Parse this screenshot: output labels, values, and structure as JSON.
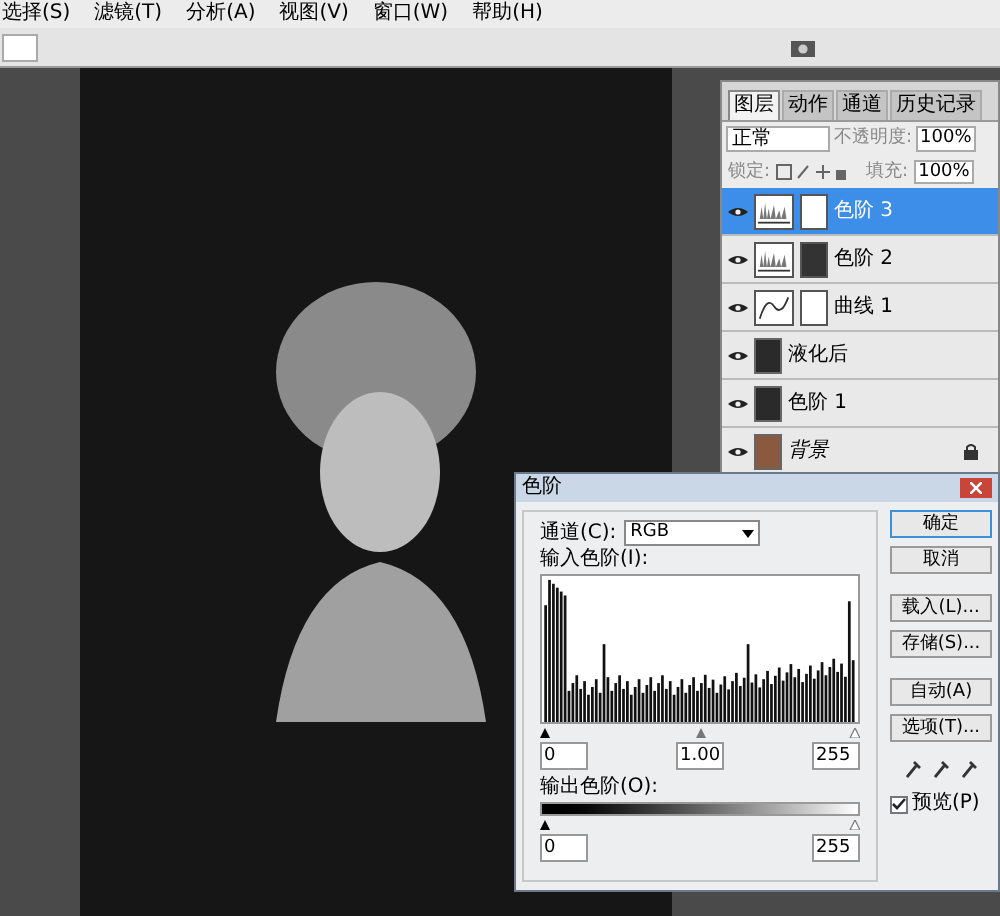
{
  "menu_bar": {
    "items": [
      "选择(S)",
      "滤镜(T)",
      "分析(A)",
      "视图(V)",
      "窗口(W)",
      "帮助(H)"
    ]
  },
  "layers_panel": {
    "tabs": [
      {
        "label": "图层",
        "selected": true
      },
      {
        "label": "动作",
        "selected": false
      },
      {
        "label": "通道",
        "selected": false
      },
      {
        "label": "历史记录",
        "selected": false
      }
    ],
    "blend_mode": "正常",
    "opacity_label": "不透明度:",
    "opacity": "100%",
    "lock_label": "锁定:",
    "fill_label": "填充:",
    "fill": "100%",
    "layers": [
      {
        "name": "色阶 3",
        "kind": "levels",
        "mask": {
          "kind": "blank"
        },
        "selected": true,
        "locked": false
      },
      {
        "name": "色阶 2",
        "kind": "levels",
        "mask": {
          "kind": "photo"
        },
        "selected": false,
        "locked": false
      },
      {
        "name": "曲线 1",
        "kind": "curves",
        "mask": {
          "kind": "blank"
        },
        "selected": false,
        "locked": false
      },
      {
        "name": "液化后",
        "kind": "pixel",
        "selected": false,
        "locked": false
      },
      {
        "name": "色阶 1",
        "kind": "pixel",
        "selected": false,
        "locked": false
      },
      {
        "name": "背景",
        "kind": "background",
        "selected": false,
        "locked": true
      }
    ]
  },
  "levels_dialog": {
    "title": "色阶",
    "channel_label": "通道(C):",
    "channel": "RGB",
    "input_label": "输入色阶(I):",
    "input_values": [
      "0",
      "1.00",
      "255"
    ],
    "output_label": "输出色阶(O):",
    "output_values": [
      "0",
      "255"
    ],
    "buttons": [
      {
        "label": "确定",
        "default": true
      },
      {
        "label": "取消",
        "default": false
      },
      {
        "label": "载入(L)...",
        "default": false
      },
      {
        "label": "存储(S)...",
        "default": false
      },
      {
        "label": "自动(A)",
        "default": false
      },
      {
        "label": "选项(T)...",
        "default": false
      }
    ],
    "preview": {
      "label": "预览(P)",
      "checked": true
    }
  }
}
